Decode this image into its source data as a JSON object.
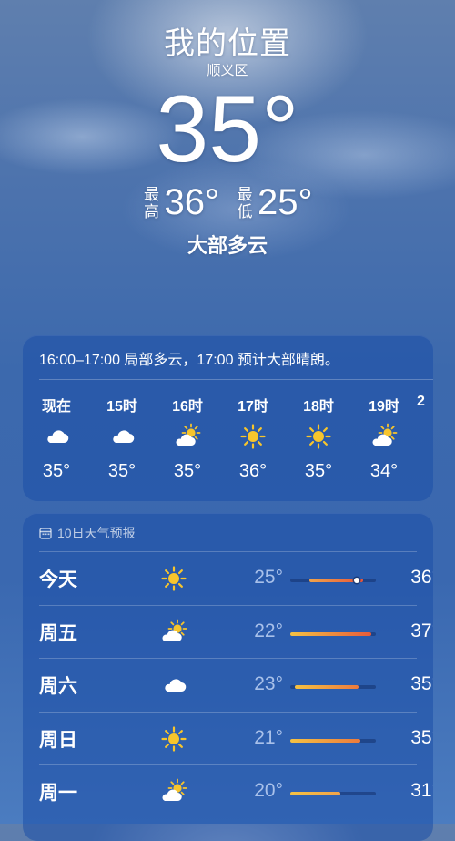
{
  "header": {
    "location": "我的位置",
    "sublocation": "顺义区",
    "temperature": "35°",
    "high_label": "最高",
    "high_value": "36°",
    "low_label": "最低",
    "low_value": "25°",
    "condition": "大部多云"
  },
  "hourly": {
    "summary": "16:00–17:00 局部多云，17:00 预计大部晴朗。",
    "items": [
      {
        "time": "现在",
        "icon": "cloud-icon",
        "temp": "35°"
      },
      {
        "time": "15时",
        "icon": "cloud-icon",
        "temp": "35°"
      },
      {
        "time": "16时",
        "icon": "partly-sunny-icon",
        "temp": "35°"
      },
      {
        "time": "17时",
        "icon": "sun-icon",
        "temp": "36°"
      },
      {
        "time": "18时",
        "icon": "sun-icon",
        "temp": "35°"
      },
      {
        "time": "19时",
        "icon": "partly-sunny-icon",
        "temp": "34°"
      },
      {
        "time": "2",
        "icon": "",
        "temp": ""
      }
    ]
  },
  "daily": {
    "title": "10日天气预报",
    "days": [
      {
        "name": "今天",
        "icon": "sun-icon",
        "low": "25°",
        "high": "36°",
        "bar_start": 0.22,
        "bar_end": 0.85,
        "bar_from": "#f0a34a",
        "bar_to": "#e8553a",
        "current": 0.78
      },
      {
        "name": "周五",
        "icon": "partly-sunny-icon",
        "low": "22°",
        "high": "37°",
        "bar_start": 0.0,
        "bar_end": 0.95,
        "bar_from": "#f5c243",
        "bar_to": "#e75b3a",
        "current": null
      },
      {
        "name": "周六",
        "icon": "cloud-icon",
        "low": "23°",
        "high": "35°",
        "bar_start": 0.05,
        "bar_end": 0.8,
        "bar_from": "#f5c243",
        "bar_to": "#ec7a3c",
        "current": null
      },
      {
        "name": "周日",
        "icon": "sun-icon",
        "low": "21°",
        "high": "35°",
        "bar_start": 0.0,
        "bar_end": 0.82,
        "bar_from": "#f5c243",
        "bar_to": "#ec7a3c",
        "current": null
      },
      {
        "name": "周一",
        "icon": "partly-sunny-icon",
        "low": "20°",
        "high": "31°",
        "bar_start": 0.0,
        "bar_end": 0.58,
        "bar_from": "#f5c243",
        "bar_to": "#f0a34a",
        "current": null
      }
    ]
  },
  "colors": {
    "sun": "#f7c52c",
    "cloud": "#ffffff"
  }
}
